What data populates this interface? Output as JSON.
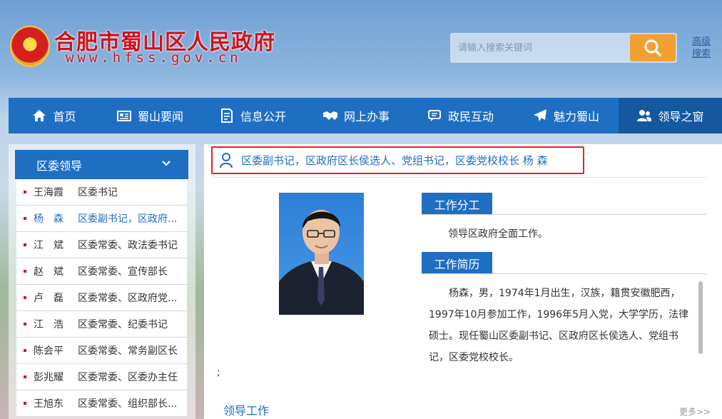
{
  "header": {
    "site_title": "合肥市蜀山区人民政府",
    "site_url": "www.hfss.gov.cn",
    "search_placeholder": "请输入搜索关键词",
    "advanced_search_line1": "高级",
    "advanced_search_line2": "搜索"
  },
  "nav": {
    "items": [
      {
        "label": "首页",
        "icon": "home-icon"
      },
      {
        "label": "蜀山要闻",
        "icon": "newspaper-icon"
      },
      {
        "label": "信息公开",
        "icon": "document-icon"
      },
      {
        "label": "网上办事",
        "icon": "handshake-icon"
      },
      {
        "label": "政民互动",
        "icon": "chat-icon"
      },
      {
        "label": "魅力蜀山",
        "icon": "paper-plane-icon"
      },
      {
        "label": "领导之窗",
        "icon": "users-icon",
        "active": true
      }
    ]
  },
  "sidebar": {
    "heading": "区委领导",
    "items": [
      {
        "name": "王海霞",
        "position": "区委书记"
      },
      {
        "name": "杨　森",
        "position": "区委副书记，区政府...",
        "active": true
      },
      {
        "name": "江　斌",
        "position": "区委常委、政法委书记"
      },
      {
        "name": "赵　斌",
        "position": "区委常委、宣传部长"
      },
      {
        "name": "卢　磊",
        "position": "区委常委、区政府党..."
      },
      {
        "name": "江　浩",
        "position": "区委常委、纪委书记"
      },
      {
        "name": "陈会平",
        "position": "区委常委、常务副区长"
      },
      {
        "name": "彭兆耀",
        "position": "区委常委、区委办主任"
      },
      {
        "name": "王旭东",
        "position": "区委常委、组织部长..."
      }
    ]
  },
  "main": {
    "title": "区委副书记，区政府区长侯选人、党组书记，区委党校校长  杨 森",
    "duty_heading": "工作分工",
    "duty_text": "领导区政府全面工作。",
    "resume_heading": "工作简历",
    "resume_text": "杨森，男，1974年1月出生，汉族，籍贯安徽肥西，1997年10月参加工作，1996年5月入党，大学学历，法律硕士。现任蜀山区委副书记、区政府区长侯选人、党组书记，区委党校校长。",
    "stray_text": ";",
    "work_heading": "领导工作",
    "more_label": "更多>>"
  },
  "colors": {
    "primary_blue": "#1e6fc2",
    "active_nav": "#1558a0",
    "title_red": "#d0121b",
    "search_orange": "#f3a032",
    "highlight_border": "#e52222"
  }
}
